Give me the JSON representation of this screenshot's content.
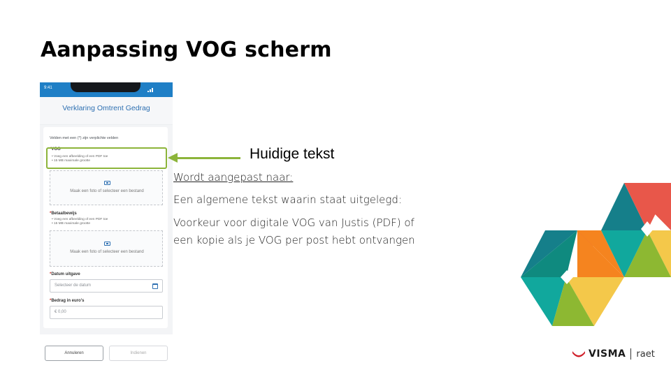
{
  "slide": {
    "title": "Aanpassing VOG scherm",
    "callout": "Huidige tekst",
    "line1": "Wordt aangepast naar:",
    "line2": "Een algemene tekst waarin staat uitgelegd:",
    "line3a": "Voorkeur voor digitale VOG van Justis (PDF) of",
    "line3b": "een kopie als je VOG per post hebt ontvangen"
  },
  "phone": {
    "time": "9:41",
    "header_title": "Verklaring Omtrent Gedrag",
    "required_note": "Velden met een (*) zijn verplichte velden",
    "vog": {
      "label": "VOG",
      "hint1": "• Voeg een afbeelding of een PDF toe",
      "hint2": "• 15 MB maximale grootte",
      "upload_text": "Maak een foto of selecteer een bestand"
    },
    "betaalbewijs": {
      "label": "Betaalbewijs",
      "hint1": "• Voeg een afbeelding of een PDF toe",
      "hint2": "• 15 MB maximale grootte",
      "upload_text": "Maak een foto of selecteer een bestand"
    },
    "datum": {
      "label": "Datum uitgave",
      "placeholder": "Selecteer de datum"
    },
    "bedrag": {
      "label": "Bedrag in euro's",
      "placeholder": "€ 0,00"
    },
    "cancel_label": "Annuleren",
    "submit_label": "Indienen"
  },
  "logo": {
    "brand": "VISMA",
    "sub": "raet"
  },
  "colors": {
    "accent_green": "#8cb43a",
    "status_blue": "#1f7fc6",
    "title_blue": "#2d6fb1"
  }
}
